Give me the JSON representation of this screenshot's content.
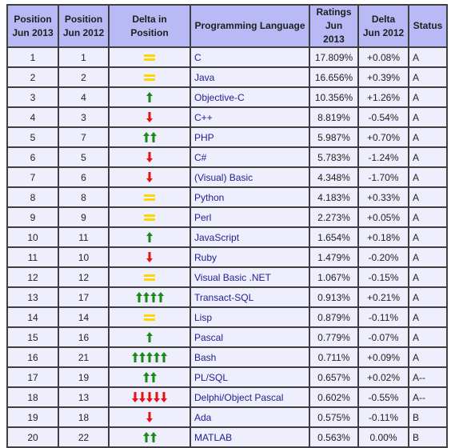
{
  "headers": {
    "pos2013": [
      "Position",
      "Jun 2013"
    ],
    "pos2012": [
      "Position",
      "Jun 2012"
    ],
    "delta_position": "Delta in Position",
    "language": "Programming Language",
    "ratings": [
      "Ratings",
      "Jun 2013"
    ],
    "delta": [
      "Delta",
      "Jun 2012"
    ],
    "status": "Status"
  },
  "colors": {
    "header_bg": "#b9b9f5",
    "cell_bg": "#eeeefc",
    "border": "#3f3f3f",
    "link": "#1f1f8f",
    "up": "#1a8a1a",
    "down": "#e81010",
    "same": "#ffd700"
  },
  "rows": [
    {
      "pos2013": "1",
      "pos2012": "1",
      "trend": "same",
      "count": 1,
      "language": "C",
      "rating": "17.809%",
      "delta": "+0.08%",
      "status": "A"
    },
    {
      "pos2013": "2",
      "pos2012": "2",
      "trend": "same",
      "count": 1,
      "language": "Java",
      "rating": "16.656%",
      "delta": "+0.39%",
      "status": "A"
    },
    {
      "pos2013": "3",
      "pos2012": "4",
      "trend": "up",
      "count": 1,
      "language": "Objective-C",
      "rating": "10.356%",
      "delta": "+1.26%",
      "status": "A"
    },
    {
      "pos2013": "4",
      "pos2012": "3",
      "trend": "down",
      "count": 1,
      "language": "C++",
      "rating": "8.819%",
      "delta": "-0.54%",
      "status": "A"
    },
    {
      "pos2013": "5",
      "pos2012": "7",
      "trend": "up",
      "count": 2,
      "language": "PHP",
      "rating": "5.987%",
      "delta": "+0.70%",
      "status": "A"
    },
    {
      "pos2013": "6",
      "pos2012": "5",
      "trend": "down",
      "count": 1,
      "language": "C#",
      "rating": "5.783%",
      "delta": "-1.24%",
      "status": "A"
    },
    {
      "pos2013": "7",
      "pos2012": "6",
      "trend": "down",
      "count": 1,
      "language": "(Visual) Basic",
      "rating": "4.348%",
      "delta": "-1.70%",
      "status": "A"
    },
    {
      "pos2013": "8",
      "pos2012": "8",
      "trend": "same",
      "count": 1,
      "language": "Python",
      "rating": "4.183%",
      "delta": "+0.33%",
      "status": "A"
    },
    {
      "pos2013": "9",
      "pos2012": "9",
      "trend": "same",
      "count": 1,
      "language": "Perl",
      "rating": "2.273%",
      "delta": "+0.05%",
      "status": "A"
    },
    {
      "pos2013": "10",
      "pos2012": "11",
      "trend": "up",
      "count": 1,
      "language": "JavaScript",
      "rating": "1.654%",
      "delta": "+0.18%",
      "status": "A"
    },
    {
      "pos2013": "11",
      "pos2012": "10",
      "trend": "down",
      "count": 1,
      "language": "Ruby",
      "rating": "1.479%",
      "delta": "-0.20%",
      "status": "A"
    },
    {
      "pos2013": "12",
      "pos2012": "12",
      "trend": "same",
      "count": 1,
      "language": "Visual Basic .NET",
      "rating": "1.067%",
      "delta": "-0.15%",
      "status": "A"
    },
    {
      "pos2013": "13",
      "pos2012": "17",
      "trend": "up",
      "count": 4,
      "language": "Transact-SQL",
      "rating": "0.913%",
      "delta": "+0.21%",
      "status": "A"
    },
    {
      "pos2013": "14",
      "pos2012": "14",
      "trend": "same",
      "count": 1,
      "language": "Lisp",
      "rating": "0.879%",
      "delta": "-0.11%",
      "status": "A"
    },
    {
      "pos2013": "15",
      "pos2012": "16",
      "trend": "up",
      "count": 1,
      "language": "Pascal",
      "rating": "0.779%",
      "delta": "-0.07%",
      "status": "A"
    },
    {
      "pos2013": "16",
      "pos2012": "21",
      "trend": "up",
      "count": 5,
      "language": "Bash",
      "rating": "0.711%",
      "delta": "+0.09%",
      "status": "A"
    },
    {
      "pos2013": "17",
      "pos2012": "19",
      "trend": "up",
      "count": 2,
      "language": "PL/SQL",
      "rating": "0.657%",
      "delta": "+0.02%",
      "status": "A--"
    },
    {
      "pos2013": "18",
      "pos2012": "13",
      "trend": "down",
      "count": 5,
      "language": "Delphi/Object Pascal",
      "rating": "0.602%",
      "delta": "-0.55%",
      "status": "A--"
    },
    {
      "pos2013": "19",
      "pos2012": "18",
      "trend": "down",
      "count": 1,
      "language": "Ada",
      "rating": "0.575%",
      "delta": "-0.11%",
      "status": "B"
    },
    {
      "pos2013": "20",
      "pos2012": "22",
      "trend": "up",
      "count": 2,
      "language": "MATLAB",
      "rating": "0.563%",
      "delta": "0.00%",
      "status": "B"
    }
  ]
}
